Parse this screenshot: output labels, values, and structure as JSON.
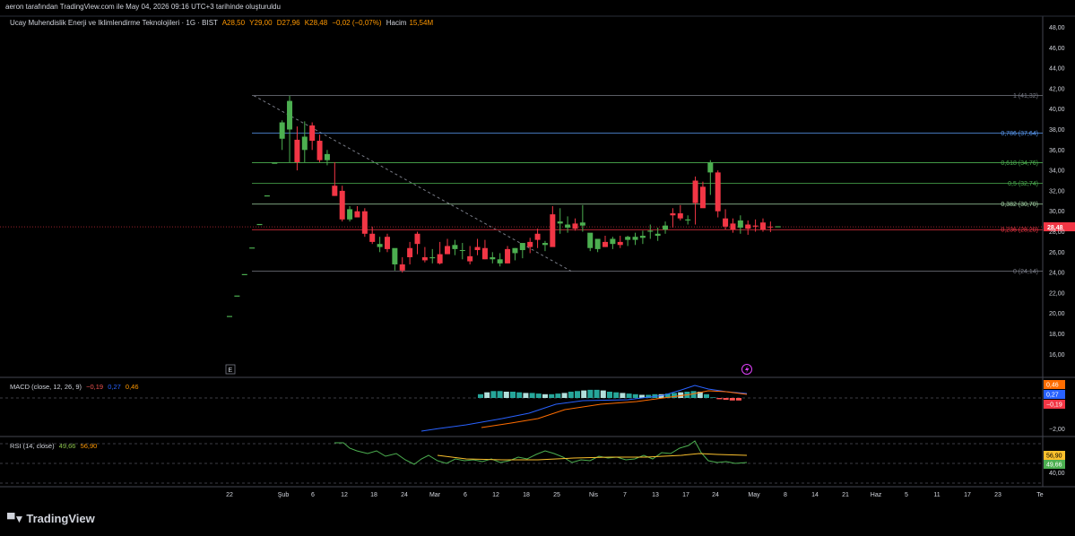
{
  "header": {
    "text": "aeron tarafından TradingView.com ile May 04, 2026 09:16 UTC+3 tarihinde oluşturuldu"
  },
  "symbol": {
    "name": "Ucay Muhendislik Enerji ve Iklimlendirme Teknolojileri · 1G · BIST",
    "open": "A28,50",
    "high": "Y29,00",
    "low": "D27,96",
    "close": "K28,48",
    "change": "−0,02 (−0,07%)",
    "volume_label": "Hacim",
    "volume": "15,54M",
    "last_price_badge": "28,48"
  },
  "price_axis": {
    "ticks": [
      "48,00",
      "46,00",
      "44,00",
      "42,00",
      "40,00",
      "38,00",
      "36,00",
      "34,00",
      "32,00",
      "30,00",
      "28,00",
      "26,00",
      "24,00",
      "22,00",
      "20,00",
      "18,00",
      "16,00"
    ]
  },
  "fibonacci": [
    {
      "label": "1 (41,32)",
      "value": 41.32,
      "color": "#787b86"
    },
    {
      "label": "0,786 (37,64)",
      "value": 37.64,
      "color": "#5b9cf6"
    },
    {
      "label": "0,618 (34,76)",
      "value": 34.76,
      "color": "#4caf50"
    },
    {
      "label": "0,5 (32,74)",
      "value": 32.74,
      "color": "#4caf50"
    },
    {
      "label": "0,382 (30,70)",
      "value": 30.7,
      "color": "#a5d6a7"
    },
    {
      "label": "0,236 (28,20)",
      "value": 28.2,
      "color": "#f23645"
    },
    {
      "label": "0 (24,14)",
      "value": 24.14,
      "color": "#787b86"
    }
  ],
  "macd": {
    "legend_title": "MACD (close, 12, 26, 9)",
    "hist": "−0,19",
    "macd": "0,27",
    "signal": "0,46",
    "axis_ticks": [
      "−2,00"
    ],
    "badges": [
      "0,46",
      "0,27",
      "−0,19"
    ]
  },
  "rsi": {
    "legend_title": "RSI (14, close)",
    "rsi": "49,66",
    "ma": "56,90",
    "axis_ticks": [
      "40,00"
    ],
    "badges": [
      "56,90",
      "49,66"
    ]
  },
  "time_axis": {
    "labels": [
      "22",
      "Şub",
      "6",
      "12",
      "18",
      "24",
      "Mar",
      "6",
      "12",
      "18",
      "25",
      "Nis",
      "7",
      "13",
      "17",
      "24",
      "May",
      "8",
      "14",
      "21",
      "Haz",
      "5",
      "11",
      "17",
      "23",
      "Te"
    ]
  },
  "buttons": {
    "e_button": "E",
    "lightning_icon": "lightning-icon"
  },
  "branding": {
    "logo_text": "TradingView"
  },
  "colors": {
    "up": "#26a69a",
    "up_candle": "#4caf50",
    "down_candle": "#f23645",
    "macd_line": "#2962ff",
    "signal_line": "#ff6d00",
    "rsi_line": "#4caf50",
    "rsi_ma": "#fbc02d"
  },
  "chart_data": {
    "type": "candlestick",
    "x": [
      "Oca-19",
      "Oca-20",
      "Oca-21",
      "Oca-22",
      "Oca-23",
      "Oca-26",
      "Oca-27",
      "Oca-28",
      "Oca-29",
      "Oca-30",
      "Şub-2",
      "Şub-3",
      "Şub-4",
      "Şub-5",
      "Şub-6",
      "Şub-9",
      "Şub-10",
      "Şub-11",
      "Şub-12",
      "Şub-13",
      "Şub-16",
      "Şub-17",
      "Şub-18",
      "Şub-19",
      "Şub-20",
      "Şub-23",
      "Şub-24",
      "Şub-25",
      "Şub-26",
      "Şub-27",
      "Mar-2",
      "Mar-3",
      "Mar-4",
      "Mar-5",
      "Mar-6",
      "Mar-9",
      "Mar-10",
      "Mar-11",
      "Mar-12",
      "Mar-13",
      "Mar-16",
      "Mar-17",
      "Mar-18",
      "Mar-19",
      "Mar-20",
      "Mar-23",
      "Mar-24",
      "Mar-25",
      "Mar-26",
      "Mar-27",
      "Mar-30",
      "Mar-31",
      "Nis-1",
      "Nis-2",
      "Nis-3",
      "Nis-6",
      "Nis-7",
      "Nis-8",
      "Nis-9",
      "Nis-10",
      "Nis-13",
      "Nis-14",
      "Nis-15",
      "Nis-16",
      "Nis-17",
      "Nis-20",
      "Nis-21",
      "Nis-22",
      "Nis-23",
      "Nis-24",
      "Nis-27",
      "Nis-28",
      "Nis-29",
      "Nis-30"
    ],
    "ohlc": [
      [
        19.7,
        19.7,
        19.7,
        19.7
      ],
      [
        21.7,
        21.7,
        21.7,
        21.7
      ],
      [
        23.8,
        23.8,
        23.8,
        23.8
      ],
      [
        26.4,
        26.4,
        26.4,
        26.4
      ],
      [
        28.7,
        28.7,
        28.7,
        28.7
      ],
      [
        31.5,
        31.5,
        31.5,
        31.5
      ],
      [
        34.7,
        34.7,
        34.7,
        34.7
      ],
      [
        37.1,
        38.9,
        36.0,
        38.7
      ],
      [
        38.0,
        41.3,
        34.8,
        40.8
      ],
      [
        37.0,
        38.3,
        34.0,
        34.8
      ],
      [
        36.0,
        38.8,
        34.8,
        37.3
      ],
      [
        38.4,
        38.7,
        36.0,
        36.9
      ],
      [
        36.9,
        37.5,
        34.8,
        35.0
      ],
      [
        35.0,
        36.0,
        34.5,
        35.6
      ],
      [
        32.5,
        34.8,
        31.5,
        31.5
      ],
      [
        32.0,
        32.5,
        29.0,
        29.2
      ],
      [
        29.2,
        30.5,
        29.0,
        30.2
      ],
      [
        30.0,
        30.5,
        29.5,
        29.4
      ],
      [
        30.0,
        30.3,
        27.5,
        27.8
      ],
      [
        27.8,
        28.5,
        26.8,
        27.0
      ],
      [
        26.5,
        27.5,
        26.0,
        26.8
      ],
      [
        27.5,
        27.8,
        26.0,
        26.3
      ],
      [
        24.8,
        26.0,
        24.2,
        26.4
      ],
      [
        24.8,
        25.5,
        24.0,
        24.2
      ],
      [
        26.4,
        27.0,
        24.8,
        25.5
      ],
      [
        27.8,
        28.0,
        25.8,
        26.8
      ],
      [
        25.5,
        26.5,
        25.0,
        25.2
      ],
      [
        25.4,
        26.3,
        24.9,
        25.5
      ],
      [
        25.8,
        27.0,
        24.8,
        24.9
      ],
      [
        26.6,
        27.3,
        25.8,
        25.8
      ],
      [
        26.3,
        27.2,
        25.7,
        26.7
      ],
      [
        26.2,
        26.9,
        25.3,
        26.2
      ],
      [
        25.6,
        26.6,
        24.8,
        25.1
      ],
      [
        26.5,
        27.3,
        25.7,
        26.2
      ],
      [
        26.4,
        27.2,
        25.3,
        25.3
      ],
      [
        25.3,
        26.0,
        24.9,
        25.5
      ],
      [
        24.9,
        25.9,
        24.6,
        25.3
      ],
      [
        26.3,
        26.6,
        24.9,
        24.9
      ],
      [
        25.9,
        26.4,
        25.2,
        26.4
      ],
      [
        26.2,
        26.6,
        25.4,
        26.9
      ],
      [
        27.0,
        27.4,
        25.9,
        26.5
      ],
      [
        27.8,
        28.3,
        26.4,
        27.2
      ],
      [
        26.7,
        27.1,
        26.1,
        26.9
      ],
      [
        29.7,
        30.5,
        26.6,
        26.5
      ],
      [
        28.8,
        30.3,
        27.8,
        29.0
      ],
      [
        28.4,
        29.5,
        27.9,
        28.7
      ],
      [
        28.8,
        29.3,
        28.1,
        28.3
      ],
      [
        28.6,
        30.6,
        28.0,
        28.9
      ],
      [
        26.4,
        27.5,
        26.1,
        27.9
      ],
      [
        26.3,
        27.3,
        26.0,
        27.3
      ],
      [
        27.0,
        27.6,
        26.5,
        26.5
      ],
      [
        26.8,
        27.5,
        26.3,
        27.3
      ],
      [
        27.0,
        27.6,
        26.4,
        26.7
      ],
      [
        27.2,
        27.6,
        26.6,
        27.5
      ],
      [
        27.2,
        27.9,
        26.7,
        27.5
      ],
      [
        27.4,
        28.1,
        26.8,
        27.6
      ],
      [
        28.0,
        28.7,
        27.3,
        28.1
      ],
      [
        27.6,
        28.4,
        27.1,
        27.8
      ],
      [
        28.2,
        29.0,
        27.8,
        28.6
      ],
      [
        29.8,
        30.3,
        28.4,
        29.6
      ],
      [
        29.8,
        30.6,
        29.1,
        29.3
      ],
      [
        29.1,
        29.6,
        28.7,
        29.2
      ],
      [
        33.0,
        33.4,
        28.7,
        30.8
      ],
      [
        32.4,
        32.9,
        30.8,
        30.3
      ],
      [
        33.8,
        35.0,
        31.6,
        34.8
      ],
      [
        33.8,
        34.0,
        29.4,
        30.0
      ],
      [
        29.3,
        30.2,
        28.2,
        28.5
      ],
      [
        28.8,
        29.3,
        27.9,
        28.2
      ],
      [
        28.4,
        29.6,
        27.8,
        29.1
      ],
      [
        28.7,
        29.1,
        27.7,
        28.3
      ],
      [
        28.6,
        29.2,
        28.0,
        28.5
      ],
      [
        28.9,
        29.3,
        28.0,
        28.2
      ],
      [
        28.5,
        29.0,
        27.96,
        28.48
      ],
      [
        28.48,
        28.48,
        28.48,
        28.48
      ]
    ],
    "fib_levels": [
      41.32,
      37.64,
      34.76,
      32.74,
      30.7,
      28.2,
      24.14
    ],
    "macd": {
      "macd": 0.27,
      "signal": 0.46,
      "hist": -0.19
    },
    "rsi": {
      "rsi": 49.66,
      "ma": 56.9
    },
    "ylim": [
      15,
      49
    ]
  }
}
